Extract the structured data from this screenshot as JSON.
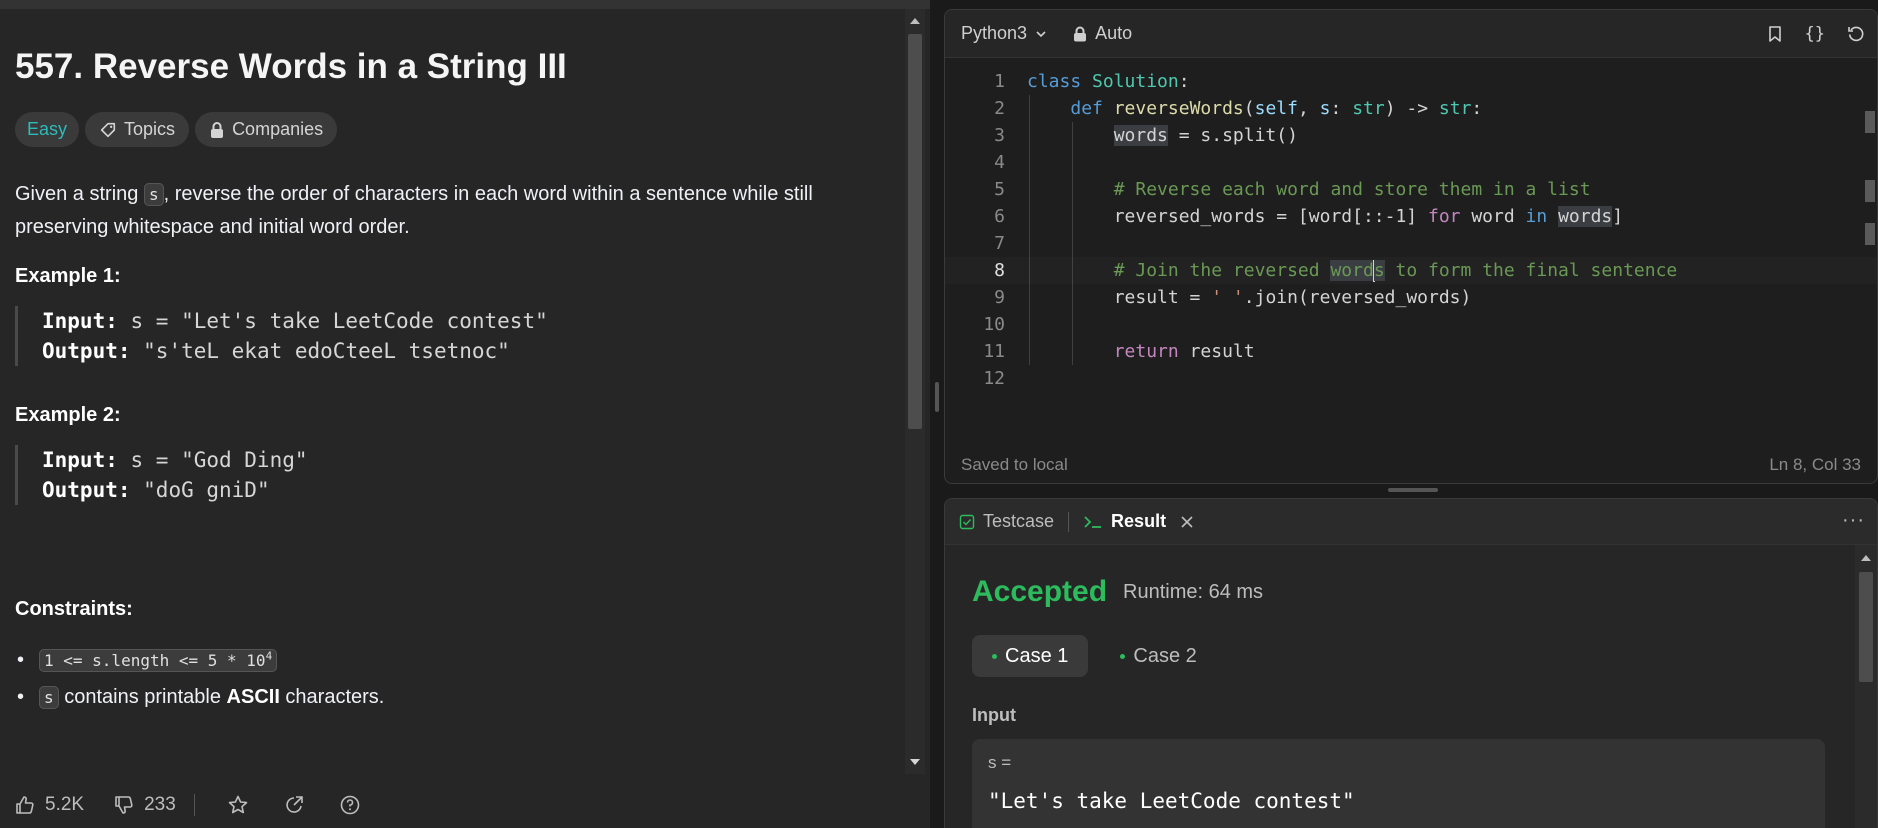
{
  "problem": {
    "title": "557. Reverse Words in a String III",
    "tags": {
      "difficulty": "Easy",
      "topics": "Topics",
      "companies": "Companies"
    },
    "desc": {
      "p1_a": "Given a string ",
      "p1_code": "s",
      "p1_b": ", reverse the order of characters in each word within a sentence while still",
      "p1_c": "preserving whitespace and initial word order."
    },
    "examples": [
      {
        "heading": "Example 1:",
        "input_label": "Input:",
        "input": " s = \"Let's take LeetCode contest\"",
        "output_label": "Output:",
        "output": " \"s'teL ekat edoCteeL tsetnoc\""
      },
      {
        "heading": "Example 2:",
        "input_label": "Input:",
        "input": " s = \"God Ding\"",
        "output_label": "Output:",
        "output": " \"doG gniD\""
      }
    ],
    "constraints_heading": "Constraints:",
    "constraints": {
      "c1_code": "1 <= s.length <= 5 * 10",
      "c1_sup": "4",
      "c2_code": "s",
      "c2_a": " contains printable ",
      "c2_b": "ASCII",
      "c2_c": " characters."
    },
    "footer": {
      "likes": "5.2K",
      "dislikes": "233"
    }
  },
  "editor": {
    "language": "Python3",
    "mode": "Auto",
    "status_left": "Saved to local",
    "status_right": "Ln 8, Col 33",
    "line_numbers": [
      "1",
      "2",
      "3",
      "4",
      "5",
      "6",
      "7",
      "8",
      "9",
      "10",
      "11",
      "12"
    ],
    "code": {
      "l1_kw": "class",
      "l1_cls": "Solution",
      "l1_p": ":",
      "l2_kw": "def",
      "l2_fn": "reverseWords",
      "l2_a": "(",
      "l2_self": "self",
      "l2_b": ", ",
      "l2_s": "s",
      "l2_c": ": ",
      "l2_t1": "str",
      "l2_d": ") -> ",
      "l2_t2": "str",
      "l2_e": ":",
      "l3_var": "words",
      "l3_rest": " = s.split()",
      "l5_cm": "# Reverse each word and store them in a list",
      "l6_a": "reversed_words = [word[::-1] ",
      "l6_for": "for",
      "l6_b": " word ",
      "l6_in": "in",
      "l6_c": " ",
      "l6_var": "words",
      "l6_d": "]",
      "l8_cm_a": "# Join the reversed ",
      "l8_cm_b": "word",
      "l8_cm_c": "s",
      "l8_cm_d": " to form the final sentence",
      "l9_a": "result = ",
      "l9_str": "' '",
      "l9_b": ".join(reversed_words)",
      "l11_kw": "return",
      "l11_rest": " result"
    }
  },
  "result": {
    "tab_testcase": "Testcase",
    "tab_result": "Result",
    "status": "Accepted",
    "runtime": "Runtime: 64 ms",
    "case1": "Case 1",
    "case2": "Case 2",
    "input_label": "Input",
    "var_label": "s =",
    "var_value": "\"Let's take LeetCode contest\""
  },
  "colors": {
    "accepted": "#2cbb5d",
    "easy": "#2cbbba"
  }
}
